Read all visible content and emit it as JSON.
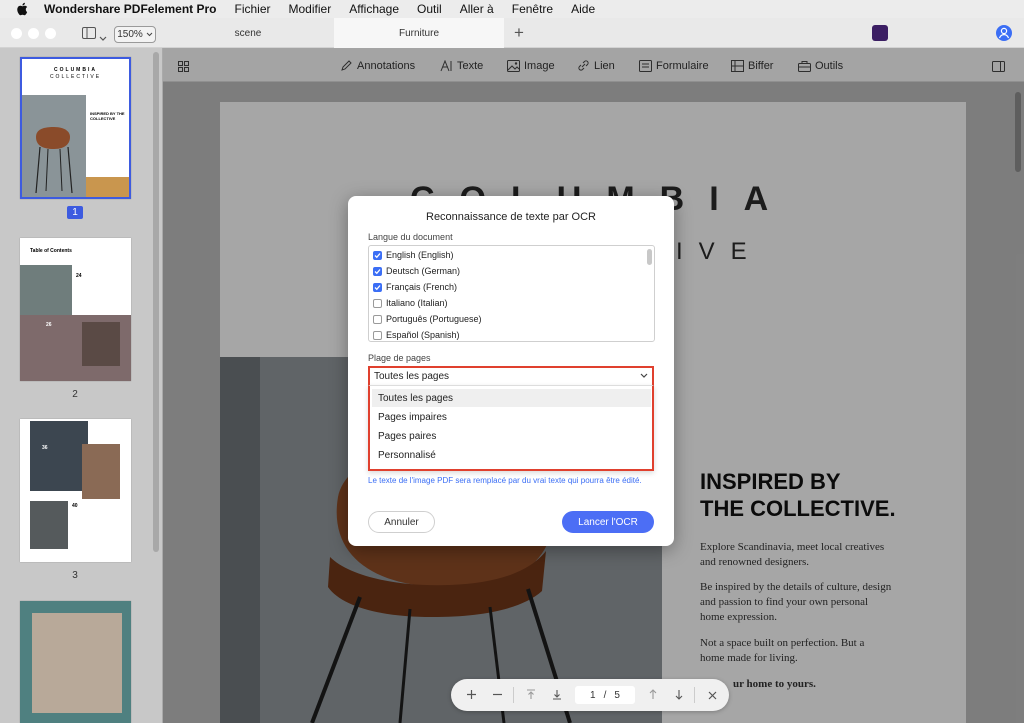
{
  "menubar": {
    "app_name": "Wondershare PDFelement Pro",
    "items": [
      "Fichier",
      "Modifier",
      "Affichage",
      "Outil",
      "Aller à",
      "Fenêtre",
      "Aide"
    ]
  },
  "titlebar": {
    "zoom": "150%",
    "tabs": [
      "scene",
      "Furniture"
    ],
    "new_tab": "+"
  },
  "toolbar": {
    "items": [
      "Annotations",
      "Texte",
      "Image",
      "Lien",
      "Formulaire",
      "Biffer",
      "Outils"
    ]
  },
  "sidebar": {
    "page_numbers": [
      "1",
      "2",
      "3"
    ],
    "thumb1": {
      "title1": "COLUMBIA",
      "title2": "COLLECTIVE",
      "heading": "INSPIRED BY THE COLLECTIVE"
    },
    "thumb2": {
      "title": "Table of Contents",
      "n1": "24",
      "n2": "26"
    },
    "thumb3": {
      "n1": "36",
      "n2": "40"
    }
  },
  "document": {
    "title1": "COLUMBIA",
    "title2": "IVE",
    "heading_line1": "INSPIRED BY",
    "heading_line2": "THE COLLECTIVE.",
    "para1": "Explore Scandinavia, meet local creatives and renowned designers.",
    "para2": "Be inspired by the details of culture, design and passion to find your own personal home expression.",
    "para3": "Not a space built on perfection. But a home made for living.",
    "para4": "ur home to yours."
  },
  "dialog": {
    "title": "Reconnaissance de texte par OCR",
    "language_label": "Langue du document",
    "languages": [
      {
        "name": "English (English)",
        "checked": true
      },
      {
        "name": "Deutsch (German)",
        "checked": true
      },
      {
        "name": "Français (French)",
        "checked": true
      },
      {
        "name": "Italiano (Italian)",
        "checked": false
      },
      {
        "name": "Português (Portuguese)",
        "checked": false
      },
      {
        "name": "Español (Spanish)",
        "checked": false
      }
    ],
    "page_range_label": "Plage de pages",
    "page_range_selected": "Toutes les pages",
    "page_range_options": [
      "Toutes les pages",
      "Pages impaires",
      "Pages paires",
      "Personnalisé"
    ],
    "note": "Le texte de l'image PDF sera remplacé par du vrai texte qui pourra être édité.",
    "cancel": "Annuler",
    "launch": "Lancer l'OCR"
  },
  "navbar": {
    "current_page": "1",
    "separator": "/",
    "total_pages": "5"
  },
  "colors": {
    "accent": "#4c6ef5",
    "highlight_border": "#e0402e",
    "selected_page": "#3d5be0"
  }
}
